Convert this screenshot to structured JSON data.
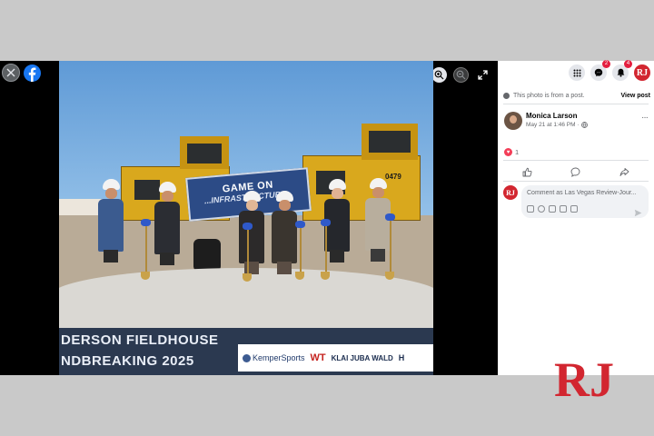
{
  "viewer": {
    "close_icon": "close-icon",
    "brand_icon": "facebook-logo-icon",
    "tools": [
      "zoom-in-icon",
      "zoom-out-icon",
      "expand-icon"
    ]
  },
  "photo": {
    "banner_line1": "GAME ON",
    "banner_line2": "...INFRASTRUCTURE...",
    "truck_number": "0479",
    "sign_line1": "DERSON FIELDHOUSE",
    "sign_line2": "NDBREAKING 2025",
    "sponsors": {
      "kemper": "KemperSports",
      "wt": "WT",
      "klai": "KLAI JUBA WALD",
      "edge": "H"
    }
  },
  "panel": {
    "topbar": {
      "menu_icon": "grid-menu-icon",
      "messenger_badge": "2",
      "notifications_badge": "4",
      "profile_initials": "RJ"
    },
    "from_post_text": "This photo is from a post.",
    "view_post_label": "View post",
    "author_name": "Monica Larson",
    "post_date": "May 21 at 1:46 PM",
    "privacy_separator": "·",
    "more_label": "···",
    "reaction_count": "1",
    "comment_placeholder": "Comment as Las Vegas Review-Jour...",
    "commenter_initials": "RJ"
  },
  "brand_logo": "RJ",
  "colors": {
    "facebook_blue": "#1877f2",
    "rj_red": "#d22630",
    "badge_red": "#e41e3f"
  }
}
